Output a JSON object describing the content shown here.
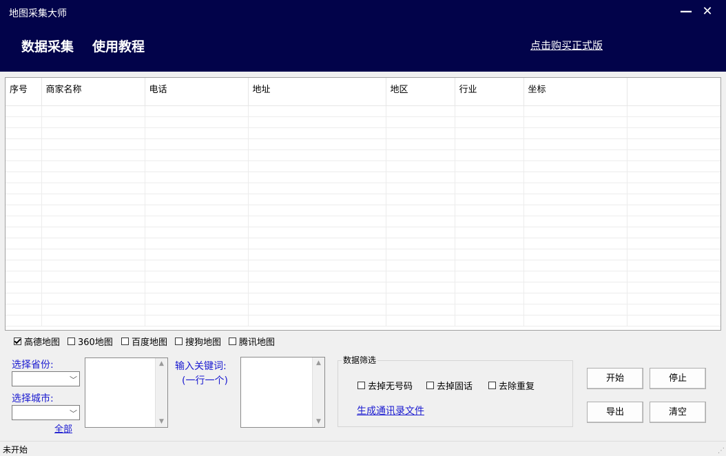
{
  "window": {
    "title": "地图采集大师",
    "minimize_icon": "minimize-icon",
    "close_icon": "close-icon",
    "minimize_glyph": "—",
    "close_glyph": "✕"
  },
  "nav": {
    "items": [
      "数据采集",
      "使用教程"
    ],
    "buy_link": "点击购买正式版"
  },
  "colors": {
    "header_bg": "#02034a",
    "link": "#1a1ad0"
  },
  "table": {
    "columns": [
      "序号",
      "商家名称",
      "电话",
      "地址",
      "地区",
      "行业",
      "坐标",
      ""
    ],
    "rows": []
  },
  "map_sources": [
    {
      "label": "高德地图",
      "checked": true
    },
    {
      "label": "360地图",
      "checked": false
    },
    {
      "label": "百度地图",
      "checked": false
    },
    {
      "label": "搜狗地图",
      "checked": false
    },
    {
      "label": "腾讯地图",
      "checked": false
    }
  ],
  "region": {
    "province_label": "选择省份:",
    "province_value": "",
    "city_label": "选择城市:",
    "city_value": "",
    "all_link": "全部",
    "list_value": ""
  },
  "keywords": {
    "label": "输入关键词:",
    "hint": "(一行一个)",
    "value": ""
  },
  "filter": {
    "title": "数据筛选",
    "options": [
      {
        "label": "去掉无号码",
        "checked": false
      },
      {
        "label": "去掉固话",
        "checked": false
      },
      {
        "label": "去除重复",
        "checked": false
      }
    ],
    "generate_link": "生成通讯录文件"
  },
  "buttons": {
    "start": "开始",
    "stop": "停止",
    "export": "导出",
    "clear": "清空"
  },
  "status": {
    "text": "未开始",
    "grip_glyph": "⋰"
  },
  "glyphs": {
    "dropdown": "﹀",
    "scroll_up": "▲",
    "scroll_down": "▼"
  }
}
